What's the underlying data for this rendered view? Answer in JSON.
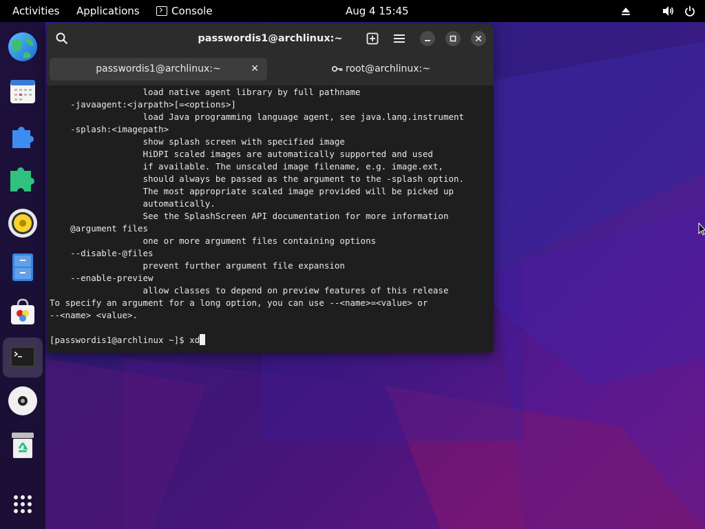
{
  "topbar": {
    "activities": "Activities",
    "applications": "Applications",
    "console": "Console",
    "clock": "Aug 4  15:45"
  },
  "dock": {
    "items": [
      {
        "name": "web-browser-icon"
      },
      {
        "name": "calendar-icon"
      },
      {
        "name": "extensions-icon"
      },
      {
        "name": "extension-manager-icon"
      },
      {
        "name": "speaker-icon"
      },
      {
        "name": "file-cabinet-icon"
      },
      {
        "name": "software-store-icon"
      },
      {
        "name": "console-icon"
      },
      {
        "name": "disc-icon"
      },
      {
        "name": "trash-icon"
      },
      {
        "name": "app-grid-icon"
      }
    ]
  },
  "terminal": {
    "title": "passwordis1@archlinux:~",
    "tabs": [
      {
        "label": "passwordis1@archlinux:~"
      },
      {
        "label": "root@archlinux:~"
      }
    ],
    "lines": [
      "                  load native agent library by full pathname",
      "    -javaagent:<jarpath>[=<options>]",
      "                  load Java programming language agent, see java.lang.instrument",
      "    -splash:<imagepath>",
      "                  show splash screen with specified image",
      "                  HiDPI scaled images are automatically supported and used",
      "                  if available. The unscaled image filename, e.g. image.ext,",
      "                  should always be passed as the argument to the -splash option.",
      "                  The most appropriate scaled image provided will be picked up",
      "                  automatically.",
      "                  See the SplashScreen API documentation for more information",
      "    @argument files",
      "                  one or more argument files containing options",
      "    --disable-@files",
      "                  prevent further argument file expansion",
      "    --enable-preview",
      "                  allow classes to depend on preview features of this release",
      "To specify an argument for a long option, you can use --<name>=<value> or",
      "--<name> <value>.",
      ""
    ],
    "prompt": "[passwordis1@archlinux ~]$ ",
    "input": "xd"
  }
}
